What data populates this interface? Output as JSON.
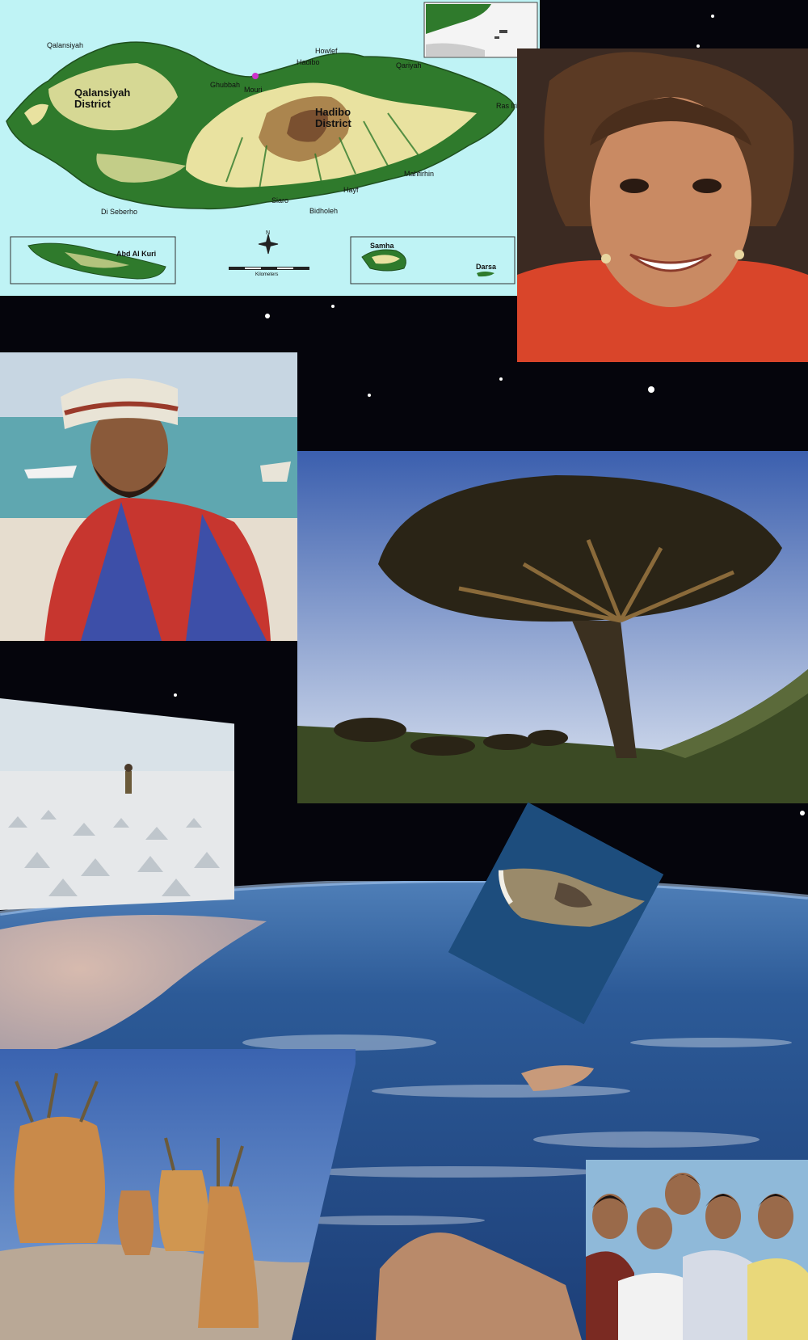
{
  "map": {
    "places": [
      "Qalansiyah",
      "Howlef",
      "Hadibo",
      "Qariyah",
      "Ghubbah",
      "Mouri",
      "Ras Irisal",
      "Mahfirhin",
      "Hayf",
      "Siaro",
      "Bidholeh",
      "Di Seberho"
    ],
    "districts": [
      "Qalansiyah District",
      "Hadibo District"
    ],
    "islands": [
      "Abd Al Kuri",
      "Samha",
      "Darsa"
    ],
    "scale_label": "Kilometers",
    "scale_ticks": [
      "0",
      "5",
      "10",
      "15",
      "20"
    ],
    "compass": "N"
  },
  "colors": {
    "sea": "#bff3f5",
    "lowland": "#2f7a2c",
    "midland": "#e9e2a0",
    "highland": "#a0743f",
    "space": "#05050c",
    "ocean": "#2d5b95"
  }
}
